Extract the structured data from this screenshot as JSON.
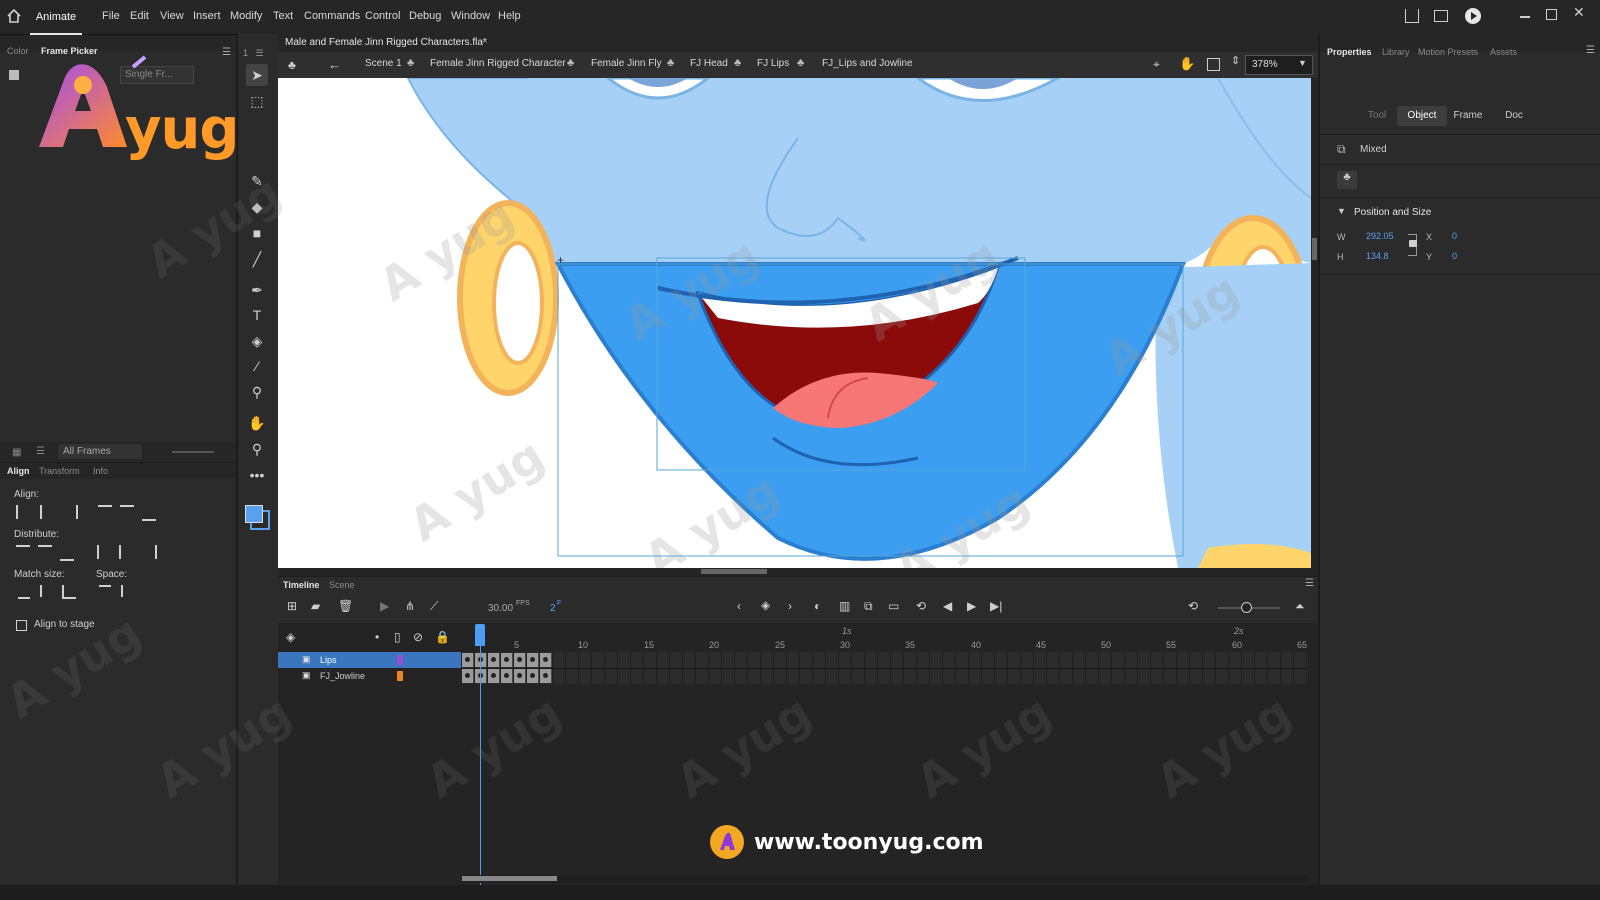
{
  "app": {
    "home_icon": "home-icon",
    "app_tab": "Animate"
  },
  "menu": [
    "File",
    "Edit",
    "View",
    "Insert",
    "Modify",
    "Text",
    "Commands",
    "Control",
    "Debug",
    "Window",
    "Help"
  ],
  "left_panel": {
    "top_tabs": [
      "Color",
      "Frame Picker"
    ],
    "frame_dropdown": "Single Fr...",
    "bottom_dropdown": "All Frames",
    "align_tabs": [
      "Align",
      "Transform",
      "Info"
    ],
    "align_label": "Align:",
    "distribute_label": "Distribute:",
    "match_size_label": "Match size:",
    "space_label": "Space:",
    "align_to_stage": "Align to stage"
  },
  "document": {
    "tab_title": "Male and Female Jinn Rigged Characters.fla*",
    "breadcrumbs": [
      "Scene 1",
      "Female Jinn Rigged Character",
      "Female Jinn Fly",
      "FJ Head",
      "FJ Lips",
      "FJ_Lips and Jowline"
    ],
    "zoom": "378%"
  },
  "timeline": {
    "tabs": [
      "Timeline",
      "Scene"
    ],
    "fps": "30.00",
    "fps_unit": "FPS",
    "current_frame": "2",
    "frame_unit": "F",
    "ruler": [
      "5",
      "10",
      "15",
      "20",
      "25",
      "30",
      "35",
      "40",
      "45",
      "50",
      "55",
      "60",
      "65"
    ],
    "seconds": [
      "1s",
      "2s"
    ],
    "layers": [
      {
        "name": "Lips",
        "color": "#9b4bd6",
        "selected": true
      },
      {
        "name": "FJ_Jowline",
        "color": "#e8871d",
        "selected": false
      }
    ]
  },
  "properties": {
    "tabs": [
      "Properties",
      "Library",
      "Motion Presets",
      "Assets"
    ],
    "segments": [
      "Tool",
      "Object",
      "Frame",
      "Doc"
    ],
    "selection": "Mixed",
    "section": "Position and Size",
    "w_label": "W",
    "w_value": "292.05",
    "h_label": "H",
    "h_value": "134.8",
    "x_label": "X",
    "x_value": "0",
    "y_label": "Y",
    "y_value": "0"
  },
  "logo_text": "yug",
  "footer_url": "www.toonyug.com",
  "colors": {
    "accent": "#3f8fe6",
    "stage_bg": "#ffffff",
    "panel": "#2b2b2b"
  }
}
